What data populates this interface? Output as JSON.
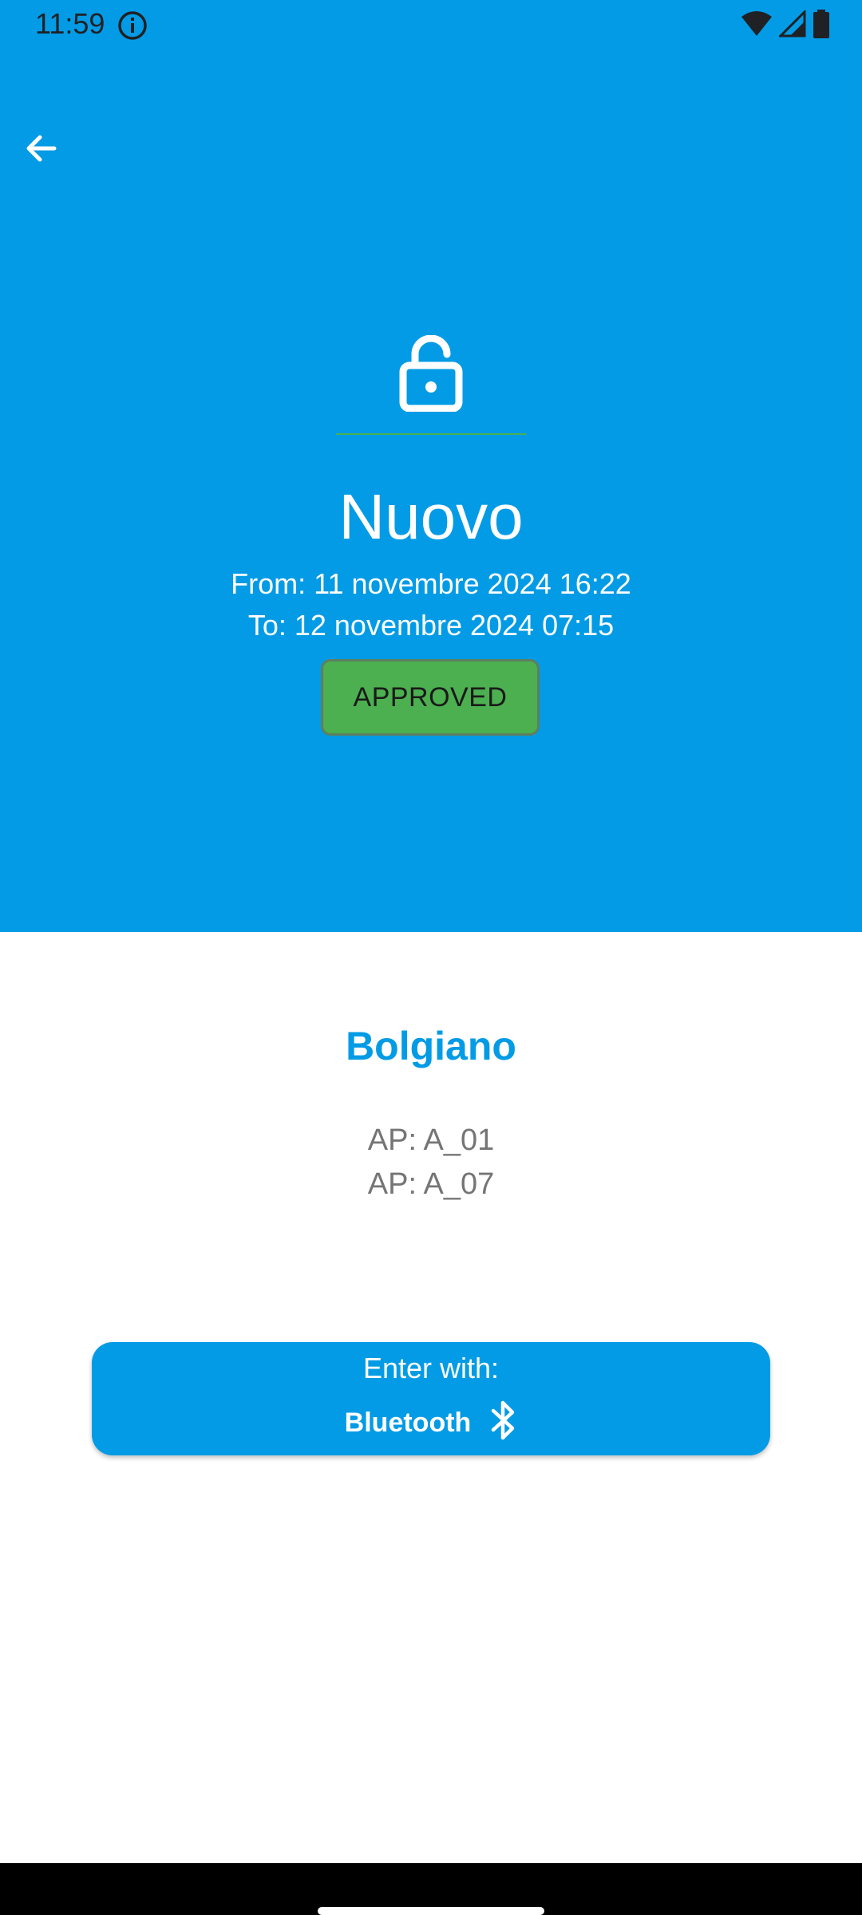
{
  "status_bar": {
    "time": "11:59",
    "icons": [
      "info-icon",
      "wifi-icon",
      "signal-icon",
      "battery-icon"
    ]
  },
  "header": {
    "background_color": "#039be5",
    "back_icon": "arrow-left-icon",
    "lock_icon": "lock-open-icon",
    "title": "Nuovo",
    "from": "From: 11 novembre 2024 16:22",
    "to": "To: 12 novembre 2024 07:15",
    "status": "APPROVED",
    "status_color": "#4caf50"
  },
  "location": {
    "name": "Bolgiano",
    "access_points": [
      "AP: A_01",
      "AP: A_07"
    ]
  },
  "enter_button": {
    "label": "Enter with:",
    "method": "Bluetooth",
    "method_icon": "bluetooth-icon"
  }
}
